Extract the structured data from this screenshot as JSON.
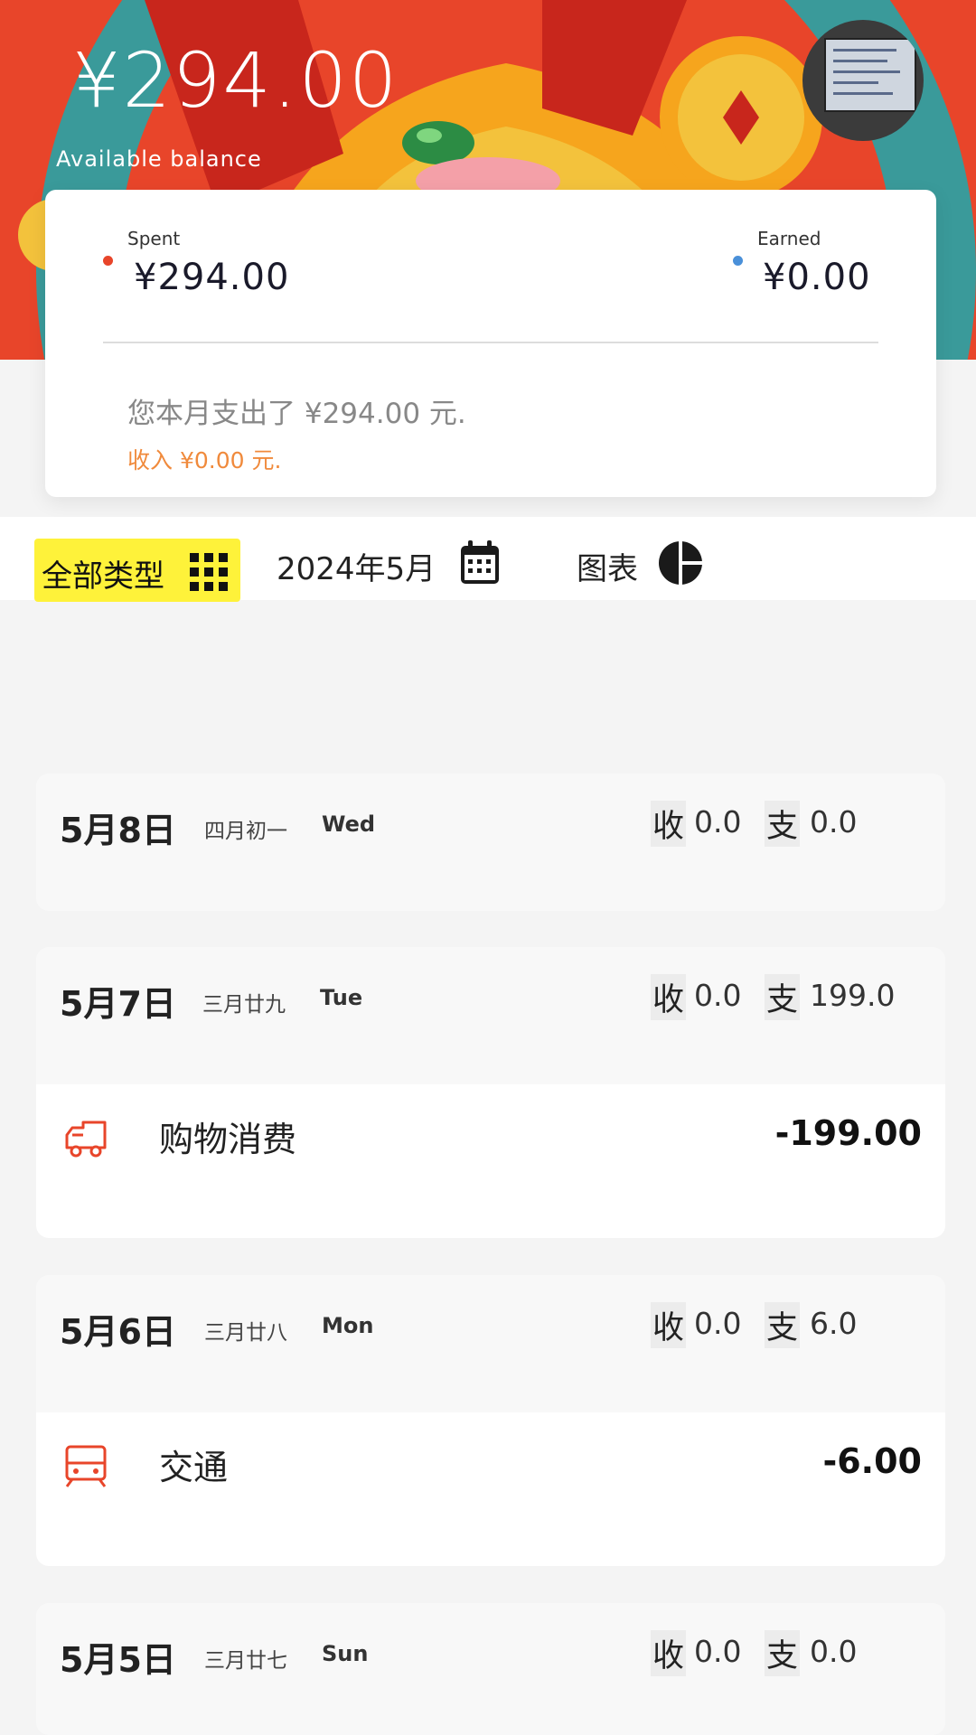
{
  "header": {
    "balance": "¥294.00",
    "balance_label": "Available balance"
  },
  "summary": {
    "spent_label": "Spent",
    "spent_value": "¥294.00",
    "earned_label": "Earned",
    "earned_value": "¥0.00",
    "month_text": "您本月支出了 ¥294.00 元.",
    "income_text": "收入 ¥0.00 元."
  },
  "filters": {
    "type_label": "全部类型",
    "month_label": "2024年5月",
    "chart_label": "图表"
  },
  "colors": {
    "accent_yellow": "#fef23a",
    "spent_dot": "#e8452a",
    "earned_dot": "#4a90d9",
    "income_orange": "#f08a3c",
    "entry_icon_red": "#e8452a"
  },
  "days": [
    {
      "date": "5月8日",
      "lunar": "四月初一",
      "weekday": "Wed",
      "in_label": "收",
      "in_value": "0.0",
      "out_label": "支",
      "out_value": "0.0",
      "entries": []
    },
    {
      "date": "5月7日",
      "lunar": "三月廿九",
      "weekday": "Tue",
      "in_label": "收",
      "in_value": "0.0",
      "out_label": "支",
      "out_value": "199.0",
      "entries": [
        {
          "category": "购物消费",
          "amount": "-199.00",
          "icon": "shopping-truck-icon"
        }
      ]
    },
    {
      "date": "5月6日",
      "lunar": "三月廿八",
      "weekday": "Mon",
      "in_label": "收",
      "in_value": "0.0",
      "out_label": "支",
      "out_value": "6.0",
      "entries": [
        {
          "category": "交通",
          "amount": "-6.00",
          "icon": "train-icon"
        }
      ]
    },
    {
      "date": "5月5日",
      "lunar": "三月廿七",
      "weekday": "Sun",
      "in_label": "收",
      "in_value": "0.0",
      "out_label": "支",
      "out_value": "0.0",
      "entries": []
    }
  ]
}
